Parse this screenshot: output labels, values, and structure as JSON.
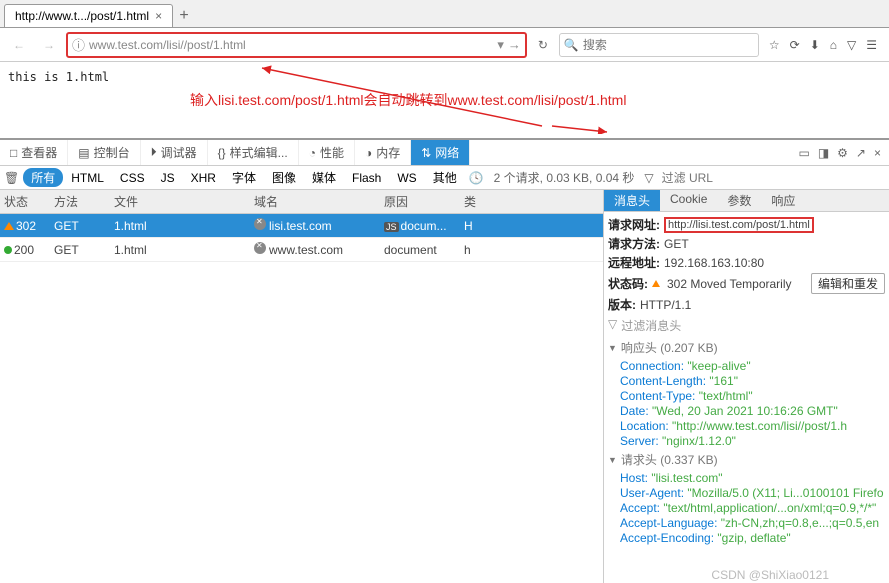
{
  "tab": {
    "title": "http://www.t.../post/1.html"
  },
  "url_bar": {
    "value": "www.test.com/lisi//post/1.html",
    "search_placeholder": "搜索"
  },
  "page": {
    "content": "this is 1.html"
  },
  "annotation": "输入lisi.test.com/post/1.html会自动跳转到www.test.com/lisi/post/1.html",
  "devtools": {
    "tabs": [
      "查看器",
      "控制台",
      "调试器",
      "样式编辑...",
      "性能",
      "内存",
      "网络"
    ],
    "active_tab": "网络",
    "filters": [
      "所有",
      "HTML",
      "CSS",
      "JS",
      "XHR",
      "字体",
      "图像",
      "媒体",
      "Flash",
      "WS",
      "其他"
    ],
    "active_filter": "所有",
    "summary": "2 个请求, 0.03 KB, 0.04 秒",
    "filter_url_placeholder": "过滤 URL",
    "columns": [
      "状态",
      "方法",
      "文件",
      "域名",
      "原因",
      "类"
    ],
    "rows": [
      {
        "status": "302",
        "method": "GET",
        "file": "1.html",
        "domain": "lisi.test.com",
        "cause": "docum...",
        "type": "H",
        "status_color": "orange",
        "js_badge": true,
        "selected": true
      },
      {
        "status": "200",
        "method": "GET",
        "file": "1.html",
        "domain": "www.test.com",
        "cause": "document",
        "type": "h",
        "status_color": "green",
        "js_badge": false,
        "selected": false
      }
    ],
    "detail": {
      "tabs": [
        "消息头",
        "Cookie",
        "参数",
        "响应"
      ],
      "active_tab": "消息头",
      "req_url_label": "请求网址:",
      "req_url": "http://lisi.test.com/post/1.html",
      "req_method_label": "请求方法:",
      "req_method": "GET",
      "remote_label": "远程地址:",
      "remote": "192.168.163.10:80",
      "status_label": "状态码:",
      "status_text": "302 Moved Temporarily",
      "edit_resend": "编辑和重发",
      "version_label": "版本:",
      "version": "HTTP/1.1",
      "filter_headers": "过滤消息头",
      "response_headers_label": "响应头 (0.207 KB)",
      "response_headers": [
        {
          "name": "Connection",
          "value": "\"keep-alive\""
        },
        {
          "name": "Content-Length",
          "value": "\"161\""
        },
        {
          "name": "Content-Type",
          "value": "\"text/html\""
        },
        {
          "name": "Date",
          "value": "\"Wed, 20 Jan 2021 10:16:26 GMT\""
        },
        {
          "name": "Location",
          "value": "\"http://www.test.com/lisi//post/1.h"
        },
        {
          "name": "Server",
          "value": "\"nginx/1.12.0\""
        }
      ],
      "request_headers_label": "请求头 (0.337 KB)",
      "request_headers": [
        {
          "name": "Host",
          "value": "\"lisi.test.com\""
        },
        {
          "name": "User-Agent",
          "value": "\"Mozilla/5.0 (X11; Li...0100101 Firefo"
        },
        {
          "name": "Accept",
          "value": "\"text/html,application/...on/xml;q=0.9,*/*\""
        },
        {
          "name": "Accept-Language",
          "value": "\"zh-CN,zh;q=0.8,e...;q=0.5,en"
        },
        {
          "name": "Accept-Encoding",
          "value": "\"gzip, deflate\""
        }
      ]
    }
  },
  "watermark": "CSDN @ShiXiao0121"
}
